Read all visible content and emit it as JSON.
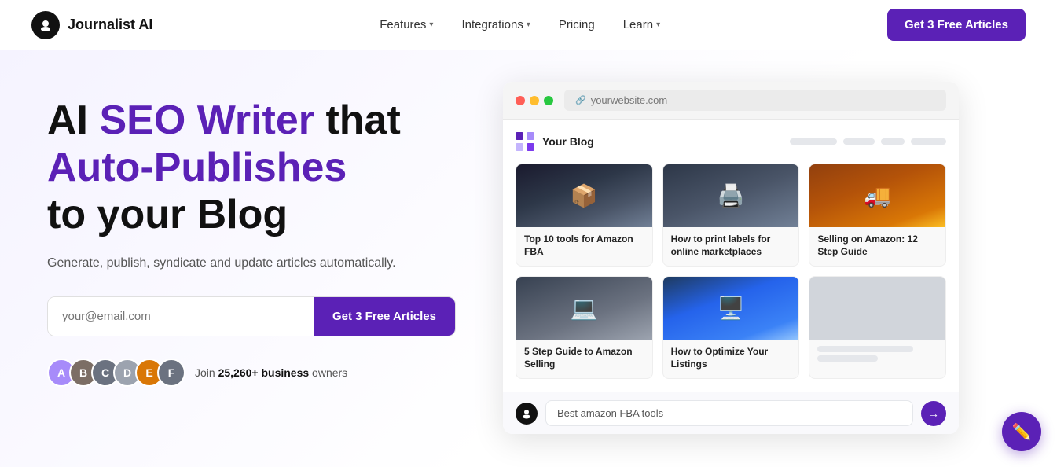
{
  "nav": {
    "logo_text": "Journalist AI",
    "links": [
      {
        "label": "Features",
        "has_dropdown": true
      },
      {
        "label": "Integrations",
        "has_dropdown": true
      },
      {
        "label": "Pricing",
        "has_dropdown": false
      },
      {
        "label": "Learn",
        "has_dropdown": true
      }
    ],
    "cta_label": "Get 3 Free Articles"
  },
  "hero": {
    "title_part1": "AI ",
    "title_purple": "SEO Writer",
    "title_part2": " that",
    "title_line2": "Auto-Publishes",
    "title_line3": "to your Blog",
    "subtitle": "Generate, publish, syndicate and update articles automatically.",
    "email_placeholder": "your@email.com",
    "cta_label": "Get 3 Free Articles",
    "social_text": "Join ",
    "social_bold": "25,260+ business",
    "social_text2": " owners"
  },
  "browser": {
    "url": "yourwebsite.com",
    "blog_name": "Your Blog",
    "cards": [
      {
        "img_type": "amazon-boxes",
        "title": "Top 10 tools for Amazon FBA"
      },
      {
        "img_type": "labels",
        "title": "How to print labels for online marketplaces"
      },
      {
        "img_type": "delivery",
        "title": "Selling on Amazon: 12 Step Guide"
      },
      {
        "img_type": "laptop-typing",
        "title": "5 Step Guide to Amazon Selling"
      },
      {
        "img_type": "laptop-screen",
        "title": "How to Optimize Your Listings"
      },
      {
        "img_type": "blank",
        "title": ""
      }
    ],
    "chat_placeholder": "Best amazon FBA tools",
    "chat_send_icon": "→"
  },
  "chat_widget": {
    "icon": "✏️"
  }
}
